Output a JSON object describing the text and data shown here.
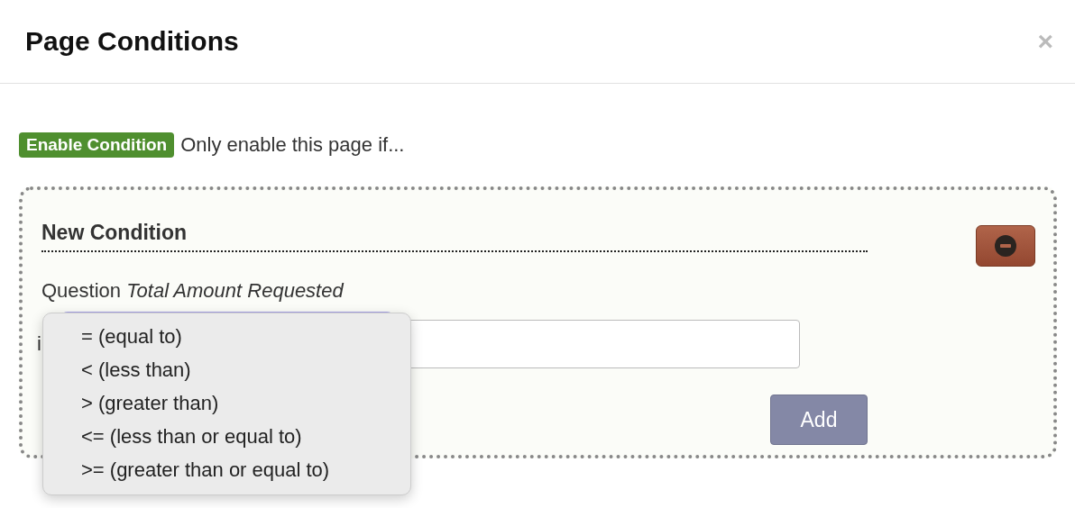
{
  "dialog": {
    "title": "Page Conditions",
    "close": "×"
  },
  "enable": {
    "badge": "Enable Condition",
    "text": "Only enable this page if..."
  },
  "condition": {
    "heading": "New Condition",
    "question": "Question *Total Amount Requested*",
    "row_label": "i",
    "add_button": "Add"
  },
  "dropdown": {
    "options": [
      {
        "label": "= (equal to)"
      },
      {
        "label": "< (less than)"
      },
      {
        "label": "> (greater than)"
      },
      {
        "label": "<= (less than or equal to)"
      },
      {
        "label": ">= (greater than or equal to)"
      }
    ]
  }
}
